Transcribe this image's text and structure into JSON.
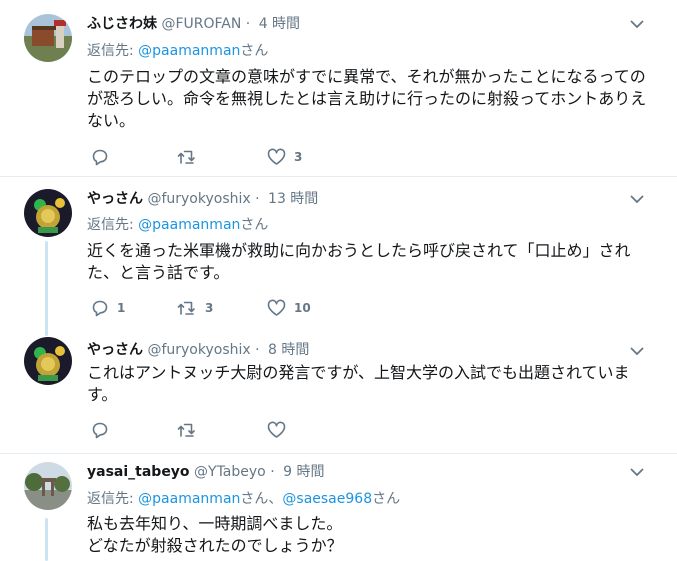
{
  "tweets": [
    {
      "name": "ふじさわ妹",
      "handle": "@FUROFAN",
      "time": "4 時間",
      "reply_prefix": "返信先: ",
      "reply_to": "@paamanman",
      "reply_suffix": "さん",
      "body": "このテロップの文章の意味がすでに異常で、それが無かったことになるってのが恐ろしい。命令を無視したとは言え助けに行ったのに射殺ってホントありえない。",
      "replies": "",
      "retweets": "",
      "likes": "3"
    },
    {
      "name": "やっさん",
      "handle": "@furyokyoshix",
      "time": "13 時間",
      "reply_prefix": "返信先: ",
      "reply_to": "@paamanman",
      "reply_suffix": "さん",
      "body": "近くを通った米軍機が救助に向かおうとしたら呼び戻されて「口止め」された、と言う話です。",
      "replies": "1",
      "retweets": "3",
      "likes": "10"
    },
    {
      "name": "やっさん",
      "handle": "@furyokyoshix",
      "time": "8 時間",
      "body": "これはアントヌッチ大尉の発言ですが、上智大学の入試でも出題されています。",
      "replies": "",
      "retweets": "",
      "likes": ""
    },
    {
      "name": "yasai_tabeyo",
      "handle": "@YTabeyo",
      "time": "9 時間",
      "reply_prefix": "返信先: ",
      "reply_to": "@paamanman",
      "reply_mid": "さん、",
      "reply_to2": "@saesae968",
      "reply_suffix": "さん",
      "body_line1": "私も去年知り、一時期調べました。",
      "body_line2": "どなたが射殺されたのでしょうか？"
    }
  ],
  "colors": {
    "link": "#1b95e0",
    "muted": "#657786",
    "text": "#14171a",
    "thread": "#cce4f2"
  }
}
